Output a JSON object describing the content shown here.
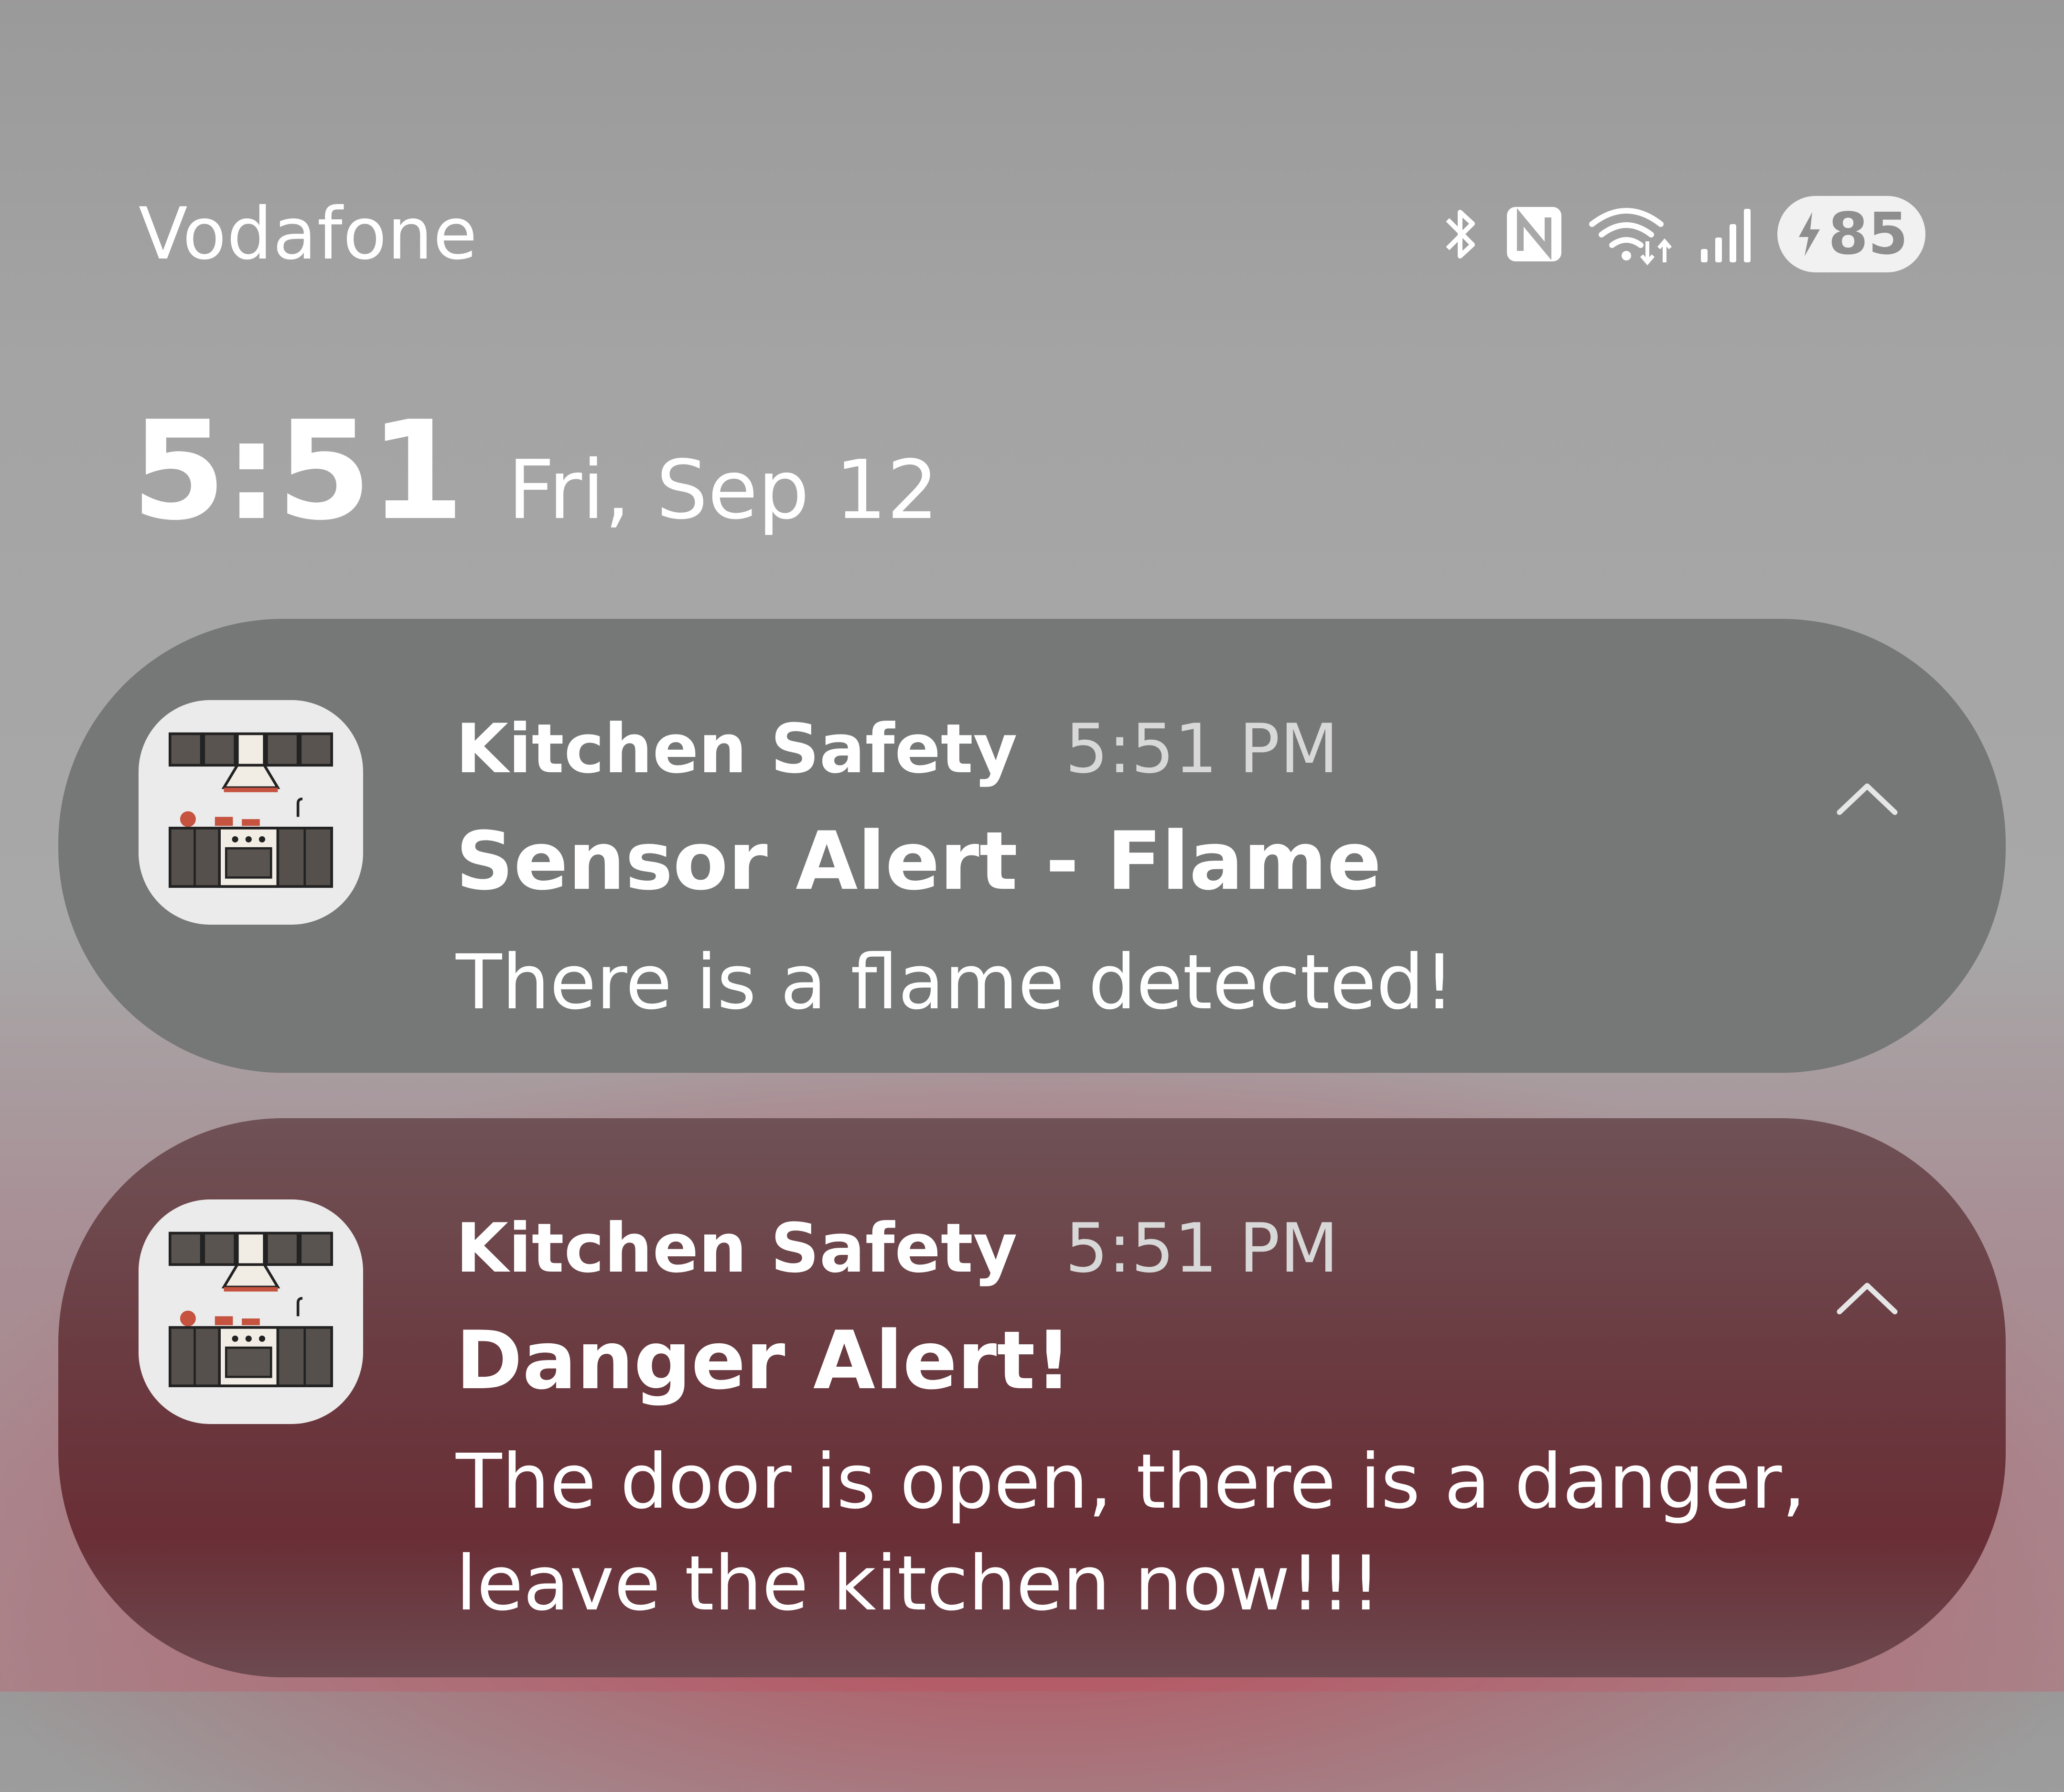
{
  "status_bar": {
    "carrier": "Vodafone",
    "battery_level": "85",
    "icons": [
      "bluetooth-icon",
      "nfc-icon",
      "wifi-icon",
      "cellular-signal-icon",
      "charging-icon"
    ]
  },
  "lockscreen": {
    "time": "5:51",
    "date": "Fri, Sep 12"
  },
  "notifications": [
    {
      "app_name": "Kitchen Safety",
      "time": "5:51 PM",
      "title": "Sensor Alert - Flame",
      "body": "There is a flame detected!",
      "icon": "kitchen-icon",
      "expand_icon": "chevron-up-icon",
      "background": "#767777"
    },
    {
      "app_name": "Kitchen Safety",
      "time": "5:51 PM",
      "title": "Danger Alert!",
      "body": "The door is open, there is a danger, leave the kitchen now!!!",
      "icon": "kitchen-icon",
      "expand_icon": "chevron-up-icon",
      "background": "#6a2e36"
    }
  ]
}
